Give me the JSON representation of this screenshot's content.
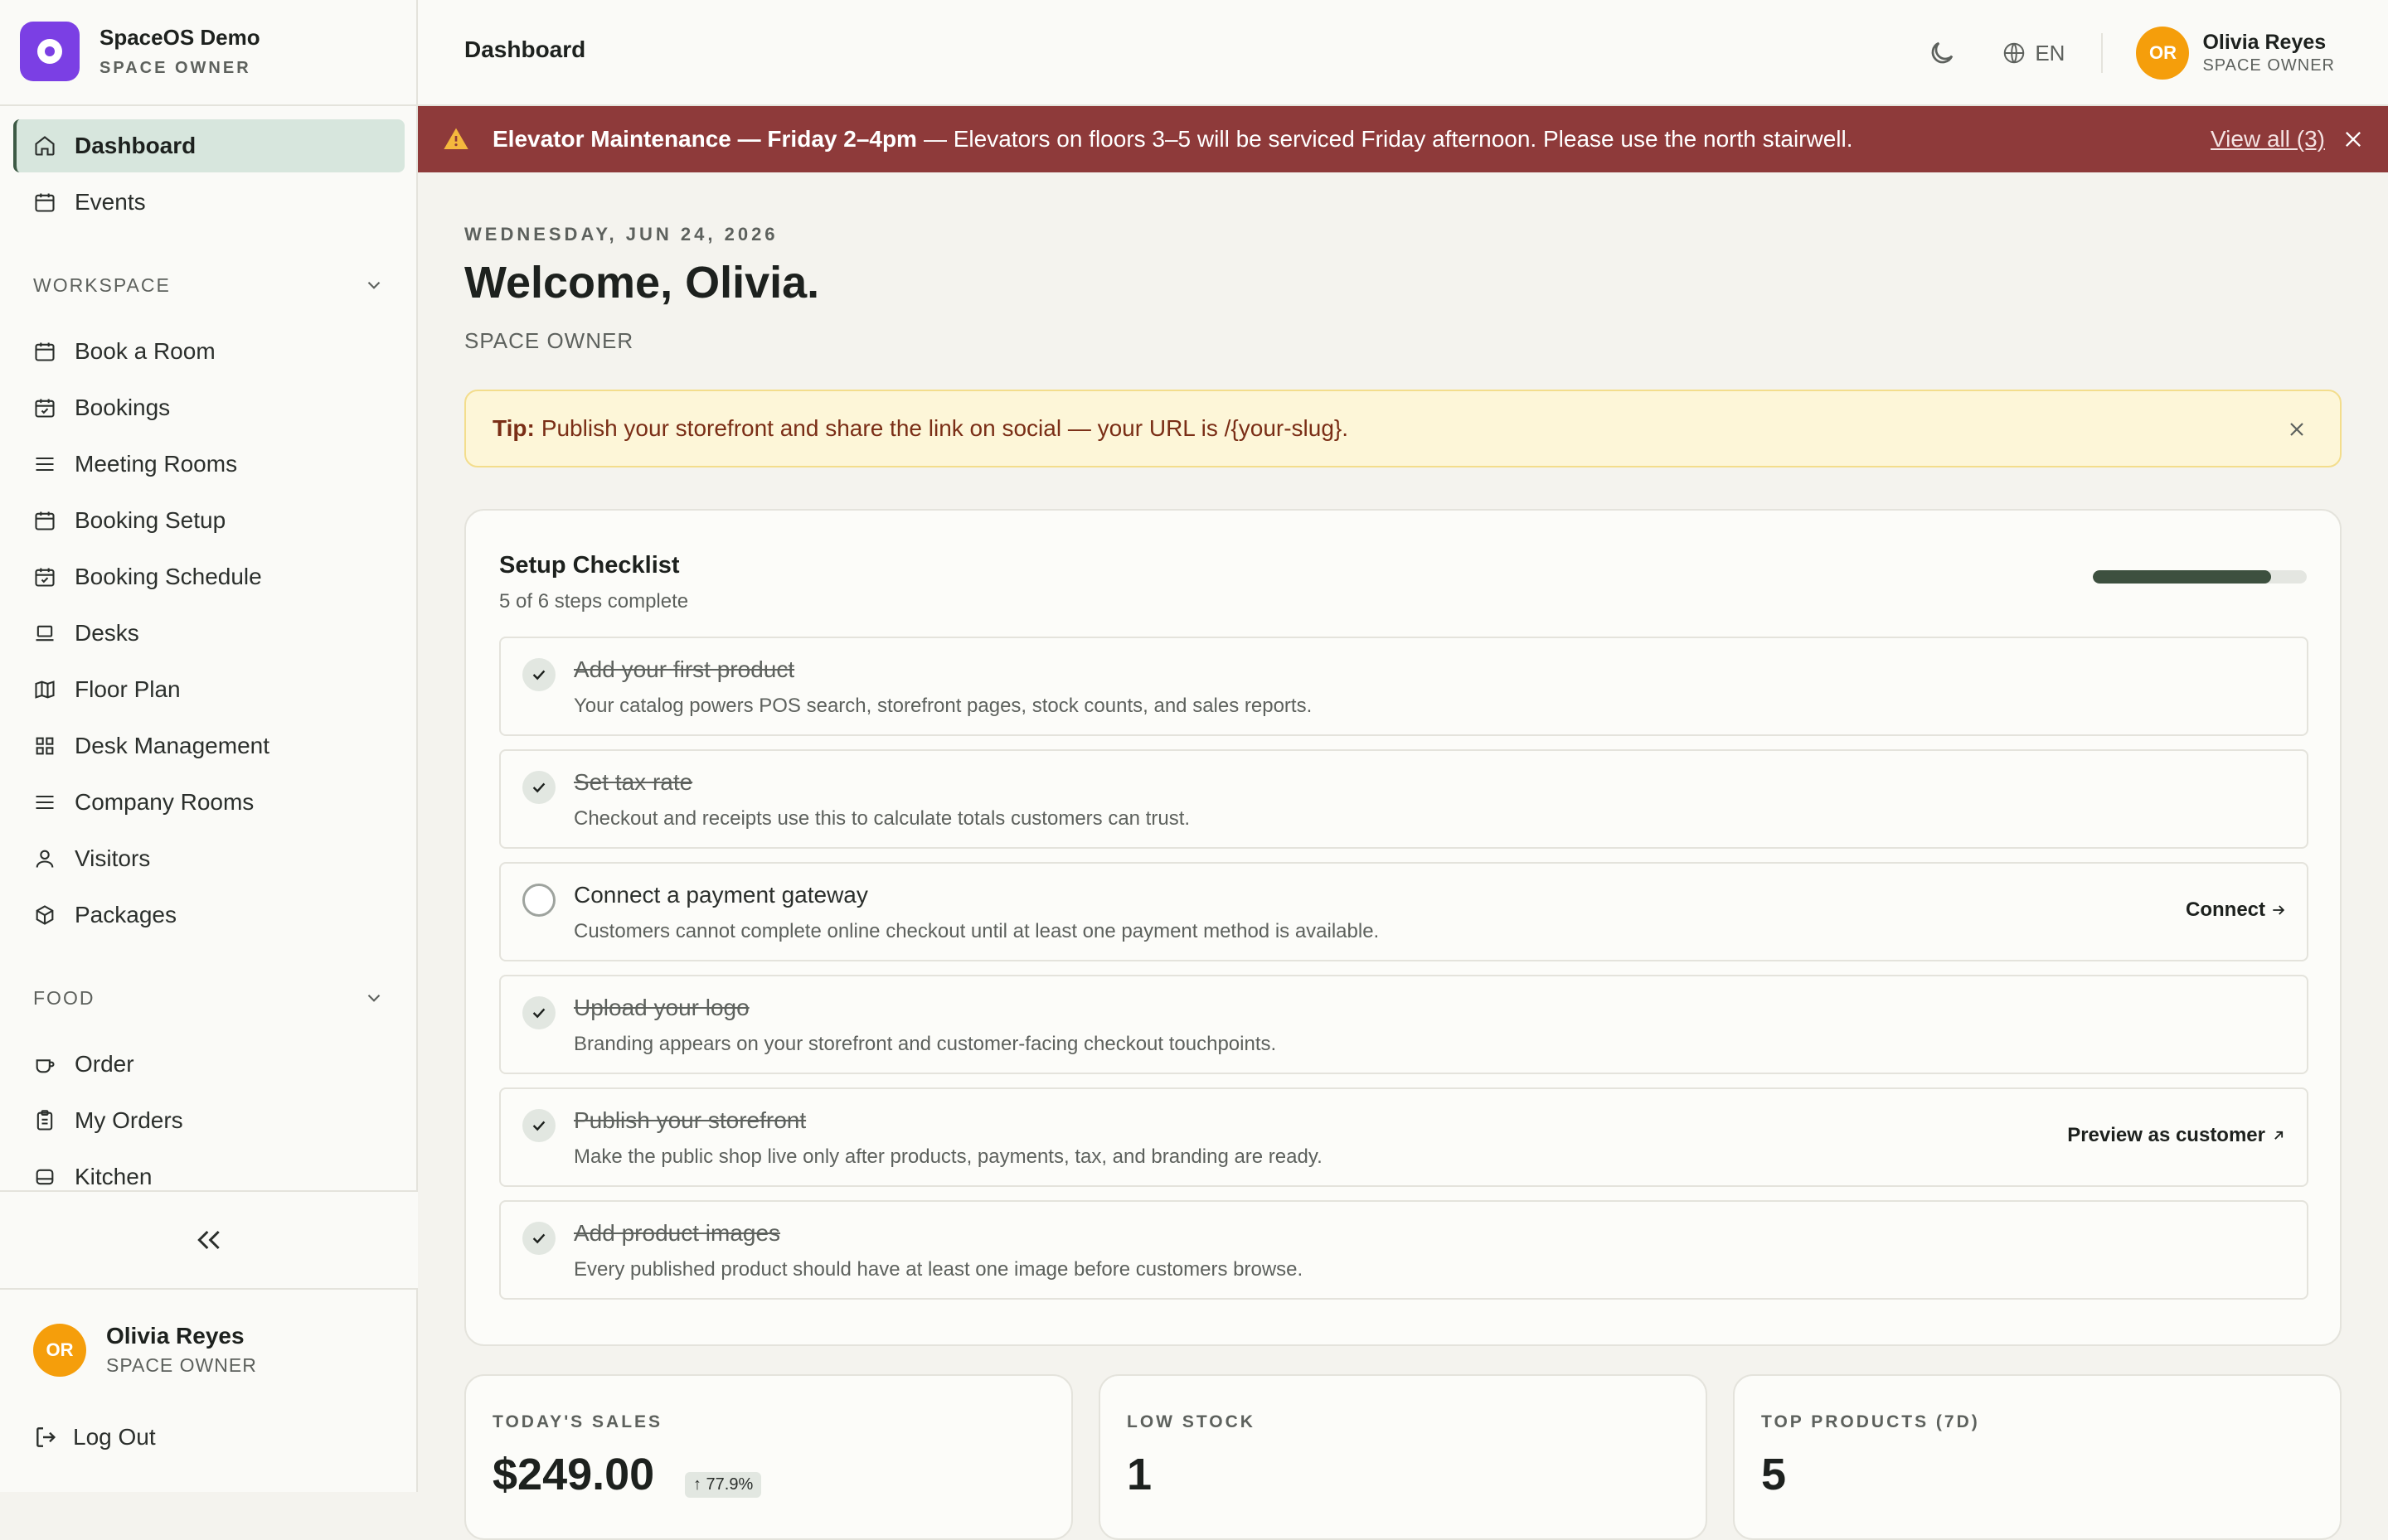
{
  "brand": {
    "name": "SpaceOS Demo",
    "role": "SPACE OWNER"
  },
  "sidebar": {
    "top_items": [
      {
        "label": "Dashboard",
        "icon": "home-icon",
        "active": true
      },
      {
        "label": "Events",
        "icon": "calendar-icon"
      }
    ],
    "workspace_label": "WORKSPACE",
    "workspace_items": [
      {
        "label": "Book a Room",
        "icon": "calendar-icon"
      },
      {
        "label": "Bookings",
        "icon": "calendar-check-icon"
      },
      {
        "label": "Meeting Rooms",
        "icon": "menu-icon"
      },
      {
        "label": "Booking Setup",
        "icon": "calendar-icon"
      },
      {
        "label": "Booking Schedule",
        "icon": "calendar-check-icon"
      },
      {
        "label": "Desks",
        "icon": "laptop-icon"
      },
      {
        "label": "Floor Plan",
        "icon": "map-icon"
      },
      {
        "label": "Desk Management",
        "icon": "grid-icon"
      },
      {
        "label": "Company Rooms",
        "icon": "menu-icon"
      },
      {
        "label": "Visitors",
        "icon": "user-icon"
      },
      {
        "label": "Packages",
        "icon": "package-icon"
      }
    ],
    "food_label": "FOOD",
    "food_items": [
      {
        "label": "Order",
        "icon": "coffee-icon"
      },
      {
        "label": "My Orders",
        "icon": "clipboard-icon"
      },
      {
        "label": "Kitchen",
        "icon": "cooking-icon"
      }
    ],
    "user": {
      "initials": "OR",
      "name": "Olivia Reyes",
      "role": "SPACE OWNER"
    },
    "logout_label": "Log Out"
  },
  "topbar": {
    "title": "Dashboard",
    "lang": "EN",
    "user": {
      "initials": "OR",
      "name": "Olivia Reyes",
      "role": "SPACE OWNER"
    }
  },
  "alert": {
    "title": "Elevator Maintenance — Friday 2–4pm",
    "message": "— Elevators on floors 3–5 will be serviced Friday afternoon. Please use the north stairwell.",
    "view_all": "View all (3)",
    "color": "#8e3a3a"
  },
  "main": {
    "date": "WEDNESDAY, JUN 24, 2026",
    "welcome": "Welcome, Olivia.",
    "role": "SPACE OWNER",
    "tip": {
      "label": "Tip:",
      "text": "Publish your storefront and share the link on social — your URL is /{your-slug}."
    }
  },
  "checklist": {
    "title": "Setup Checklist",
    "subtitle": "5 of 6 steps complete",
    "progress": 0.833,
    "steps": [
      {
        "title": "Add your first product",
        "desc": "Your catalog powers POS search, storefront pages, stock counts, and sales reports.",
        "done": true,
        "action": ""
      },
      {
        "title": "Set tax rate",
        "desc": "Checkout and receipts use this to calculate totals customers can trust.",
        "done": true,
        "action": ""
      },
      {
        "title": "Connect a payment gateway",
        "desc": "Customers cannot complete online checkout until at least one payment method is available.",
        "done": false,
        "action": "Connect"
      },
      {
        "title": "Upload your logo",
        "desc": "Branding appears on your storefront and customer-facing checkout touchpoints.",
        "done": true,
        "action": ""
      },
      {
        "title": "Publish your storefront",
        "desc": "Make the public shop live only after products, payments, tax, and branding are ready.",
        "done": true,
        "action": "Preview as customer"
      },
      {
        "title": "Add product images",
        "desc": "Every published product should have at least one image before customers browse.",
        "done": true,
        "action": ""
      }
    ]
  },
  "stats": [
    {
      "label": "TODAY'S SALES",
      "value": "$249.00",
      "badge": "↑ 77.9%"
    },
    {
      "label": "LOW STOCK",
      "value": "1",
      "badge": ""
    },
    {
      "label": "TOP PRODUCTS (7D)",
      "value": "5",
      "badge": ""
    }
  ]
}
